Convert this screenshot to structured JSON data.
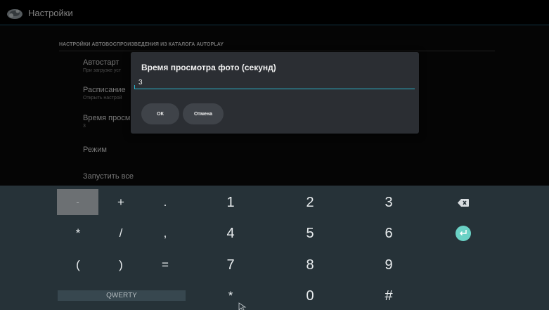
{
  "app": {
    "title": "Настройки"
  },
  "settings": {
    "section_header": "НАСТРОЙКИ АВТОВОСПРОИЗВЕДЕНИЯ ИЗ КАТАЛОГА AUTOPLAY",
    "items": [
      {
        "title": "Автостарт",
        "summary": "При загрузке уст"
      },
      {
        "title": "Расписание",
        "summary": "Открыть настрой"
      },
      {
        "title": "Время просм",
        "summary": "3"
      },
      {
        "title": "Режим",
        "summary": ""
      },
      {
        "title": "Запустить все",
        "summary": ""
      }
    ]
  },
  "dialog": {
    "title": "Время просмотра фото (секунд)",
    "input_value": "3",
    "ok_label": "ОК",
    "cancel_label": "Отмена"
  },
  "keyboard": {
    "rows": [
      [
        "-",
        "+",
        ".",
        "1",
        "2",
        "3",
        "backspace"
      ],
      [
        "*",
        "/",
        ",",
        "4",
        "5",
        "6",
        "enter"
      ],
      [
        "(",
        ")",
        "=",
        "7",
        "8",
        "9",
        ""
      ],
      [
        "QWERTY",
        "",
        "",
        "*",
        "0",
        "#",
        ""
      ]
    ],
    "focused_key": "-",
    "accent_color": "#6ad1c5"
  }
}
